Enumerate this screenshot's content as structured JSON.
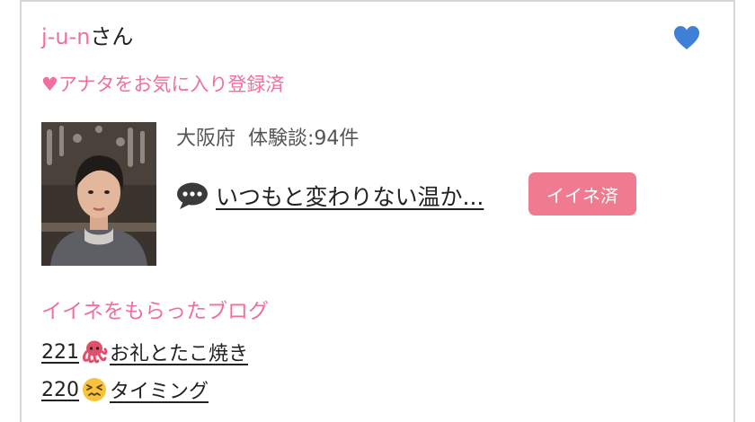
{
  "header": {
    "username": "j-u-n",
    "honorific": "さん",
    "favorite_status": "♥アナタをお気に入り登録済"
  },
  "profile": {
    "prefecture": "大阪府",
    "experience_count": "体験談:94件",
    "latest_review": "いつもと変わりない温か...",
    "iine_label": "イイネ済"
  },
  "blogs": {
    "heading": "イイネをもらったブログ",
    "items": [
      {
        "number": "221",
        "emoji": "octopus-icon",
        "title": "お礼とたこ焼き"
      },
      {
        "number": "220",
        "emoji": "confounded-face-icon",
        "title": "タイミング"
      }
    ]
  },
  "colors": {
    "pink": "#ef6fa0",
    "button": "#f07a8f",
    "heart": "#3f7fd8",
    "border": "#d6d6d6"
  }
}
